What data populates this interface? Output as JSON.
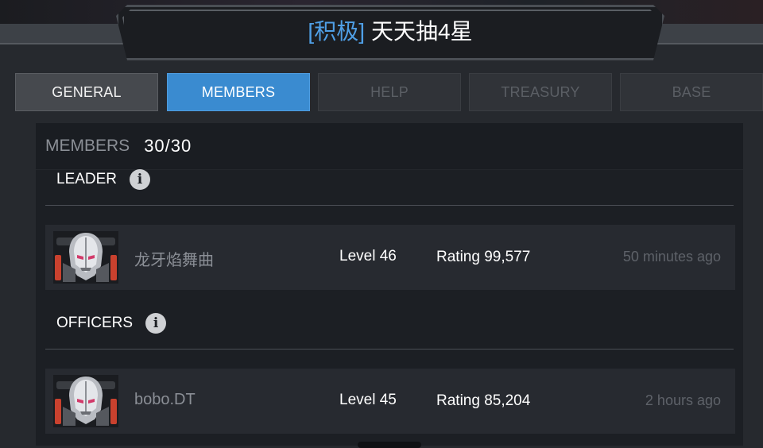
{
  "header": {
    "tag": "[积极]",
    "title": "天天抽4星"
  },
  "tabs": [
    {
      "label": "GENERAL",
      "state": "normal"
    },
    {
      "label": "MEMBERS",
      "state": "active"
    },
    {
      "label": "HELP",
      "state": "disabled"
    },
    {
      "label": "TREASURY",
      "state": "disabled"
    },
    {
      "label": "BASE",
      "state": "disabled"
    }
  ],
  "members": {
    "label": "MEMBERS",
    "count": "30/30"
  },
  "sections": {
    "leader": {
      "title": "LEADER",
      "info_icon": "info-icon",
      "rows": [
        {
          "name": "龙牙焰舞曲",
          "level": "Level 46",
          "rating": "Rating 99,577",
          "last_seen": "50 minutes ago",
          "avatar_icon": "ultron-avatar-icon"
        }
      ]
    },
    "officers": {
      "title": "OFFICERS",
      "info_icon": "info-icon",
      "rows": [
        {
          "name": "bobo.DT",
          "level": "Level 45",
          "rating": "Rating 85,204",
          "last_seen": "2 hours ago",
          "avatar_icon": "ultron-avatar-icon"
        }
      ]
    }
  },
  "colors": {
    "accent_blue": "#3a8bd0",
    "tag_blue": "#4f9fe6",
    "background": "#26292e",
    "panel": "#1c1f24"
  }
}
